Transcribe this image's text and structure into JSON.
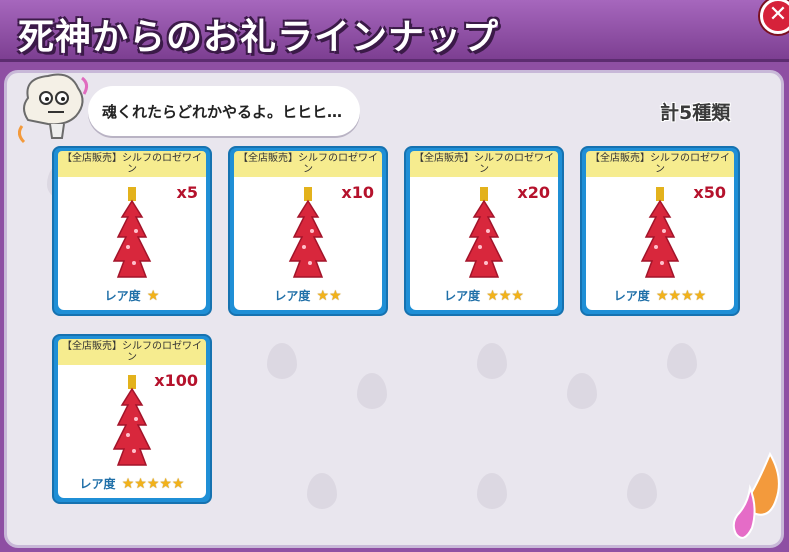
{
  "header": {
    "title": "死神からのお礼ラインナップ",
    "close_icon": "close-icon",
    "close_symbol": "✕"
  },
  "speech": {
    "text": "魂くれたらどれかやるよ。ヒヒヒ…"
  },
  "count_label": "計5種類",
  "items": [
    {
      "name": "【全店販売】シルフのロゼワイン",
      "quantity": "x5",
      "rarity_label": "レア度",
      "stars": 1,
      "stars_text": "★"
    },
    {
      "name": "【全店販売】シルフのロゼワイン",
      "quantity": "x10",
      "rarity_label": "レア度",
      "stars": 2,
      "stars_text": "★★"
    },
    {
      "name": "【全店販売】シルフのロゼワイン",
      "quantity": "x20",
      "rarity_label": "レア度",
      "stars": 3,
      "stars_text": "★★★"
    },
    {
      "name": "【全店販売】シルフのロゼワイン",
      "quantity": "x50",
      "rarity_label": "レア度",
      "stars": 4,
      "stars_text": "★★★★"
    },
    {
      "name": "【全店販売】シルフのロゼワイン",
      "quantity": "x100",
      "rarity_label": "レア度",
      "stars": 5,
      "stars_text": "★★★★★"
    }
  ],
  "colors": {
    "header": "#8e4fa3",
    "card_border": "#1f8fd6",
    "name_band": "#f6ec8f",
    "quantity": "#b5122c",
    "star": "#f2b21a"
  }
}
